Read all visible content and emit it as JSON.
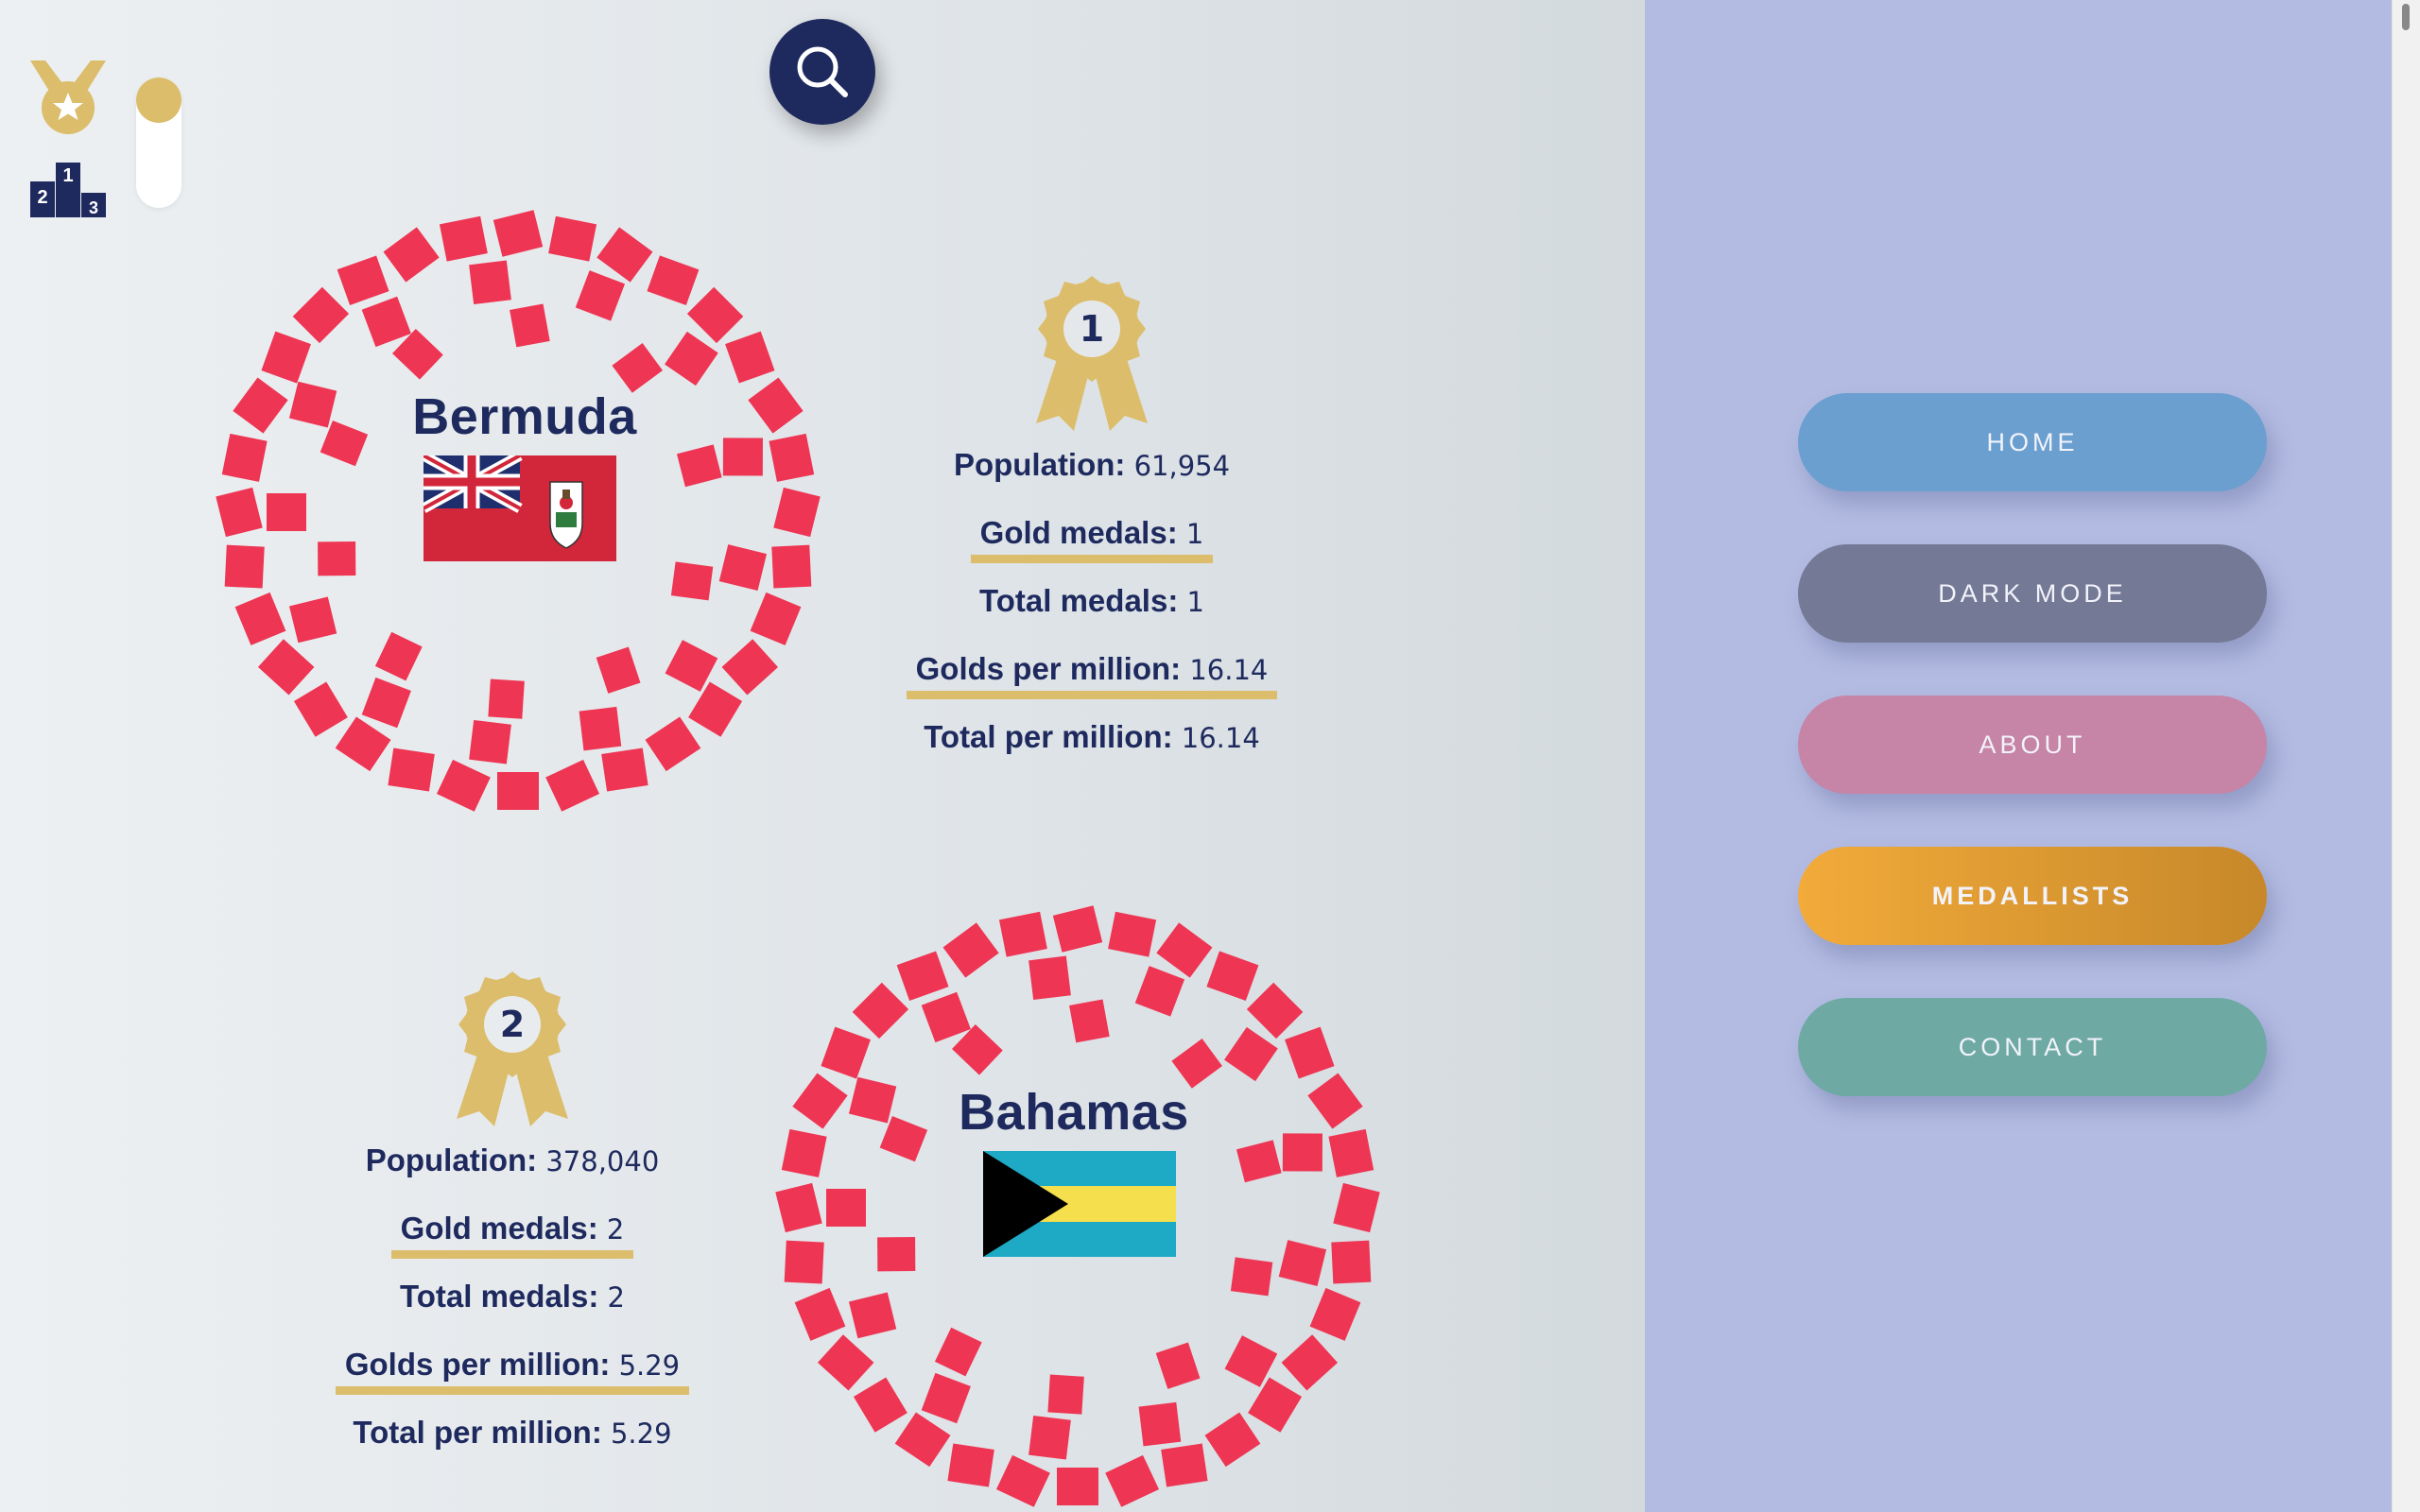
{
  "search": {
    "icon": "search-icon"
  },
  "toggle": {
    "icon_top": "medal-icon",
    "icon_bottom": "podium-icon",
    "podium_labels": [
      "1",
      "2",
      "3"
    ]
  },
  "countries": [
    {
      "rank": "1",
      "name": "Bermuda",
      "flag": "bermuda-flag",
      "stats": {
        "population_label": "Population:",
        "population": "61,954",
        "gold_label": "Gold medals:",
        "gold": "1",
        "total_label": "Total medals:",
        "total": "1",
        "gpm_label": "Golds per million:",
        "gpm": "16.14",
        "tpm_label": "Total per million:",
        "tpm": "16.14"
      }
    },
    {
      "rank": "2",
      "name": "Bahamas",
      "flag": "bahamas-flag",
      "stats": {
        "population_label": "Population:",
        "population": "378,040",
        "gold_label": "Gold medals:",
        "gold": "2",
        "total_label": "Total medals:",
        "total": "2",
        "gpm_label": "Golds per million:",
        "gpm": "5.29",
        "tpm_label": "Total per million:",
        "tpm": "5.29"
      }
    }
  ],
  "nav": {
    "home": "HOME",
    "dark_mode": "DARK MODE",
    "about": "ABOUT",
    "medallists": "MEDALLISTS",
    "contact": "CONTACT"
  },
  "colors": {
    "accent_gold": "#dcbd6c",
    "navy": "#1e2a5e",
    "wreath_red": "#ee3553",
    "sidebar": "#b3bbe2",
    "home": "#6b9fd0",
    "dark_mode": "#747a96",
    "about": "#c684a7",
    "medallists": "#f2ab3a",
    "contact": "#6ea9a4"
  }
}
